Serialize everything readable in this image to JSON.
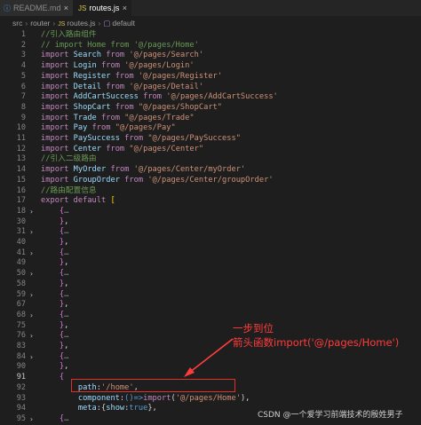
{
  "tabs": [
    {
      "icon": "ⓘ",
      "label": "README.md",
      "close": "×"
    },
    {
      "icon": "JS",
      "label": "routes.js",
      "close": "×"
    }
  ],
  "breadcrumb": [
    "src",
    "router",
    "routes.js",
    "default"
  ],
  "lines": [
    {
      "n": "1",
      "parts": [
        [
          "cm",
          "//引入路由组件"
        ]
      ]
    },
    {
      "n": "2",
      "parts": [
        [
          "cm",
          "// import Home from '@/pages/Home'"
        ]
      ]
    },
    {
      "n": "3",
      "parts": [
        [
          "kw",
          "import "
        ],
        [
          "id",
          "Search"
        ],
        [
          "kw",
          " from "
        ],
        [
          "st",
          "'@/pages/Search'"
        ]
      ]
    },
    {
      "n": "4",
      "parts": [
        [
          "kw",
          "import "
        ],
        [
          "id",
          "Login"
        ],
        [
          "kw",
          " from "
        ],
        [
          "st",
          "'@/pages/Login'"
        ]
      ]
    },
    {
      "n": "5",
      "parts": [
        [
          "kw",
          "import "
        ],
        [
          "id",
          "Register"
        ],
        [
          "kw",
          " from "
        ],
        [
          "st",
          "'@/pages/Register'"
        ]
      ]
    },
    {
      "n": "6",
      "parts": [
        [
          "kw",
          "import "
        ],
        [
          "id",
          "Detail"
        ],
        [
          "kw",
          " from "
        ],
        [
          "st",
          "'@/pages/Detail'"
        ]
      ]
    },
    {
      "n": "7",
      "parts": [
        [
          "kw",
          "import "
        ],
        [
          "id",
          "AddCartSuccess"
        ],
        [
          "kw",
          " from "
        ],
        [
          "st",
          "'@/pages/AddCartSuccess'"
        ]
      ]
    },
    {
      "n": "8",
      "parts": [
        [
          "kw",
          "import "
        ],
        [
          "id",
          "ShopCart"
        ],
        [
          "kw",
          " from "
        ],
        [
          "st",
          "\"@/pages/ShopCart\""
        ]
      ]
    },
    {
      "n": "9",
      "parts": [
        [
          "kw",
          "import "
        ],
        [
          "id",
          "Trade"
        ],
        [
          "kw",
          " from "
        ],
        [
          "st",
          "\"@/pages/Trade\""
        ]
      ]
    },
    {
      "n": "10",
      "parts": [
        [
          "kw",
          "import "
        ],
        [
          "id",
          "Pay"
        ],
        [
          "kw",
          " from "
        ],
        [
          "st",
          "\"@/pages/Pay\""
        ]
      ]
    },
    {
      "n": "11",
      "parts": [
        [
          "kw",
          "import "
        ],
        [
          "id",
          "PaySuccess"
        ],
        [
          "kw",
          " from "
        ],
        [
          "st",
          "\"@/pages/PaySuccess\""
        ]
      ]
    },
    {
      "n": "12",
      "parts": [
        [
          "kw",
          "import "
        ],
        [
          "id",
          "Center"
        ],
        [
          "kw",
          " from "
        ],
        [
          "st",
          "\"@/pages/Center\""
        ]
      ]
    },
    {
      "n": "13",
      "parts": [
        [
          "cm",
          "//引入二级路由"
        ]
      ]
    },
    {
      "n": "14",
      "parts": [
        [
          "kw",
          "import "
        ],
        [
          "id",
          "MyOrder"
        ],
        [
          "kw",
          " from "
        ],
        [
          "st",
          "'@/pages/Center/myOrder'"
        ]
      ]
    },
    {
      "n": "15",
      "parts": [
        [
          "kw",
          "import "
        ],
        [
          "id",
          "GroupOrder"
        ],
        [
          "kw",
          " from "
        ],
        [
          "st",
          "'@/pages/Center/groupOrder'"
        ]
      ]
    },
    {
      "n": "16",
      "parts": [
        [
          "cm",
          "//路由配置信息"
        ]
      ]
    },
    {
      "n": "17",
      "parts": [
        [
          "kw",
          "export "
        ],
        [
          "kw",
          "default "
        ],
        [
          "br",
          "["
        ]
      ]
    },
    {
      "n": "18",
      "fold": true,
      "parts": [
        [
          "pu",
          "    "
        ],
        [
          "br2",
          "{"
        ],
        [
          "dots",
          "…"
        ]
      ]
    },
    {
      "n": "30",
      "parts": [
        [
          "pu",
          "    "
        ],
        [
          "br2",
          "}"
        ],
        [
          "pu",
          ","
        ]
      ]
    },
    {
      "n": "31",
      "fold": true,
      "parts": [
        [
          "pu",
          "    "
        ],
        [
          "br2",
          "{"
        ],
        [
          "dots",
          "…"
        ]
      ]
    },
    {
      "n": "40",
      "parts": [
        [
          "pu",
          "    "
        ],
        [
          "br2",
          "}"
        ],
        [
          "pu",
          ","
        ]
      ]
    },
    {
      "n": "41",
      "fold": true,
      "parts": [
        [
          "pu",
          "    "
        ],
        [
          "br2",
          "{"
        ],
        [
          "dots",
          "…"
        ]
      ]
    },
    {
      "n": "49",
      "parts": [
        [
          "pu",
          "    "
        ],
        [
          "br2",
          "}"
        ],
        [
          "pu",
          ","
        ]
      ]
    },
    {
      "n": "50",
      "fold": true,
      "parts": [
        [
          "pu",
          "    "
        ],
        [
          "br2",
          "{"
        ],
        [
          "dots",
          "…"
        ]
      ]
    },
    {
      "n": "58",
      "parts": [
        [
          "pu",
          "    "
        ],
        [
          "br2",
          "}"
        ],
        [
          "pu",
          ","
        ]
      ]
    },
    {
      "n": "59",
      "fold": true,
      "parts": [
        [
          "pu",
          "    "
        ],
        [
          "br2",
          "{"
        ],
        [
          "dots",
          "…"
        ]
      ]
    },
    {
      "n": "67",
      "parts": [
        [
          "pu",
          "    "
        ],
        [
          "br2",
          "}"
        ],
        [
          "pu",
          ","
        ]
      ]
    },
    {
      "n": "68",
      "fold": true,
      "parts": [
        [
          "pu",
          "    "
        ],
        [
          "br2",
          "{"
        ],
        [
          "dots",
          "…"
        ]
      ]
    },
    {
      "n": "75",
      "parts": [
        [
          "pu",
          "    "
        ],
        [
          "br2",
          "}"
        ],
        [
          "pu",
          ","
        ]
      ]
    },
    {
      "n": "76",
      "fold": true,
      "parts": [
        [
          "pu",
          "    "
        ],
        [
          "br2",
          "{"
        ],
        [
          "dots",
          "…"
        ]
      ]
    },
    {
      "n": "83",
      "parts": [
        [
          "pu",
          "    "
        ],
        [
          "br2",
          "}"
        ],
        [
          "pu",
          ","
        ]
      ]
    },
    {
      "n": "84",
      "fold": true,
      "parts": [
        [
          "pu",
          "    "
        ],
        [
          "br2",
          "{"
        ],
        [
          "dots",
          "…"
        ]
      ]
    },
    {
      "n": "90",
      "parts": [
        [
          "pu",
          "    "
        ],
        [
          "br2",
          "}"
        ],
        [
          "pu",
          ","
        ]
      ]
    },
    {
      "n": "91",
      "active": true,
      "parts": [
        [
          "pu",
          "    "
        ],
        [
          "br2",
          "{"
        ]
      ]
    },
    {
      "n": "92",
      "parts": [
        [
          "pu",
          "        "
        ],
        [
          "id",
          "path"
        ],
        [
          "pu",
          ":"
        ],
        [
          "st",
          "'/home'"
        ],
        [
          "pu",
          ","
        ]
      ]
    },
    {
      "n": "93",
      "parts": [
        [
          "pu",
          "        "
        ],
        [
          "id",
          "component"
        ],
        [
          "pu",
          ":"
        ],
        [
          "df",
          "()"
        ],
        [
          "df",
          "=>"
        ],
        [
          "kw",
          "import"
        ],
        [
          "pu",
          "("
        ],
        [
          "st",
          "'@/pages/Home'"
        ],
        [
          "pu",
          "),"
        ]
      ]
    },
    {
      "n": "94",
      "parts": [
        [
          "pu",
          "        "
        ],
        [
          "id",
          "meta"
        ],
        [
          "pu",
          ":{"
        ],
        [
          "id",
          "show"
        ],
        [
          "pu",
          ":"
        ],
        [
          "df",
          "true"
        ],
        [
          "pu",
          "},"
        ]
      ]
    },
    {
      "n": "95",
      "fold": true,
      "parts": [
        [
          "pu",
          "    "
        ],
        [
          "br2",
          "{"
        ],
        [
          "dots",
          "…"
        ]
      ]
    }
  ],
  "callout": {
    "line1": "一步到位",
    "line2": "箭头函数import('@/pages/Home')",
    "color": "#ff3c3c"
  },
  "watermark": "CSDN @一个爱学习前端技术的殷姓男子"
}
